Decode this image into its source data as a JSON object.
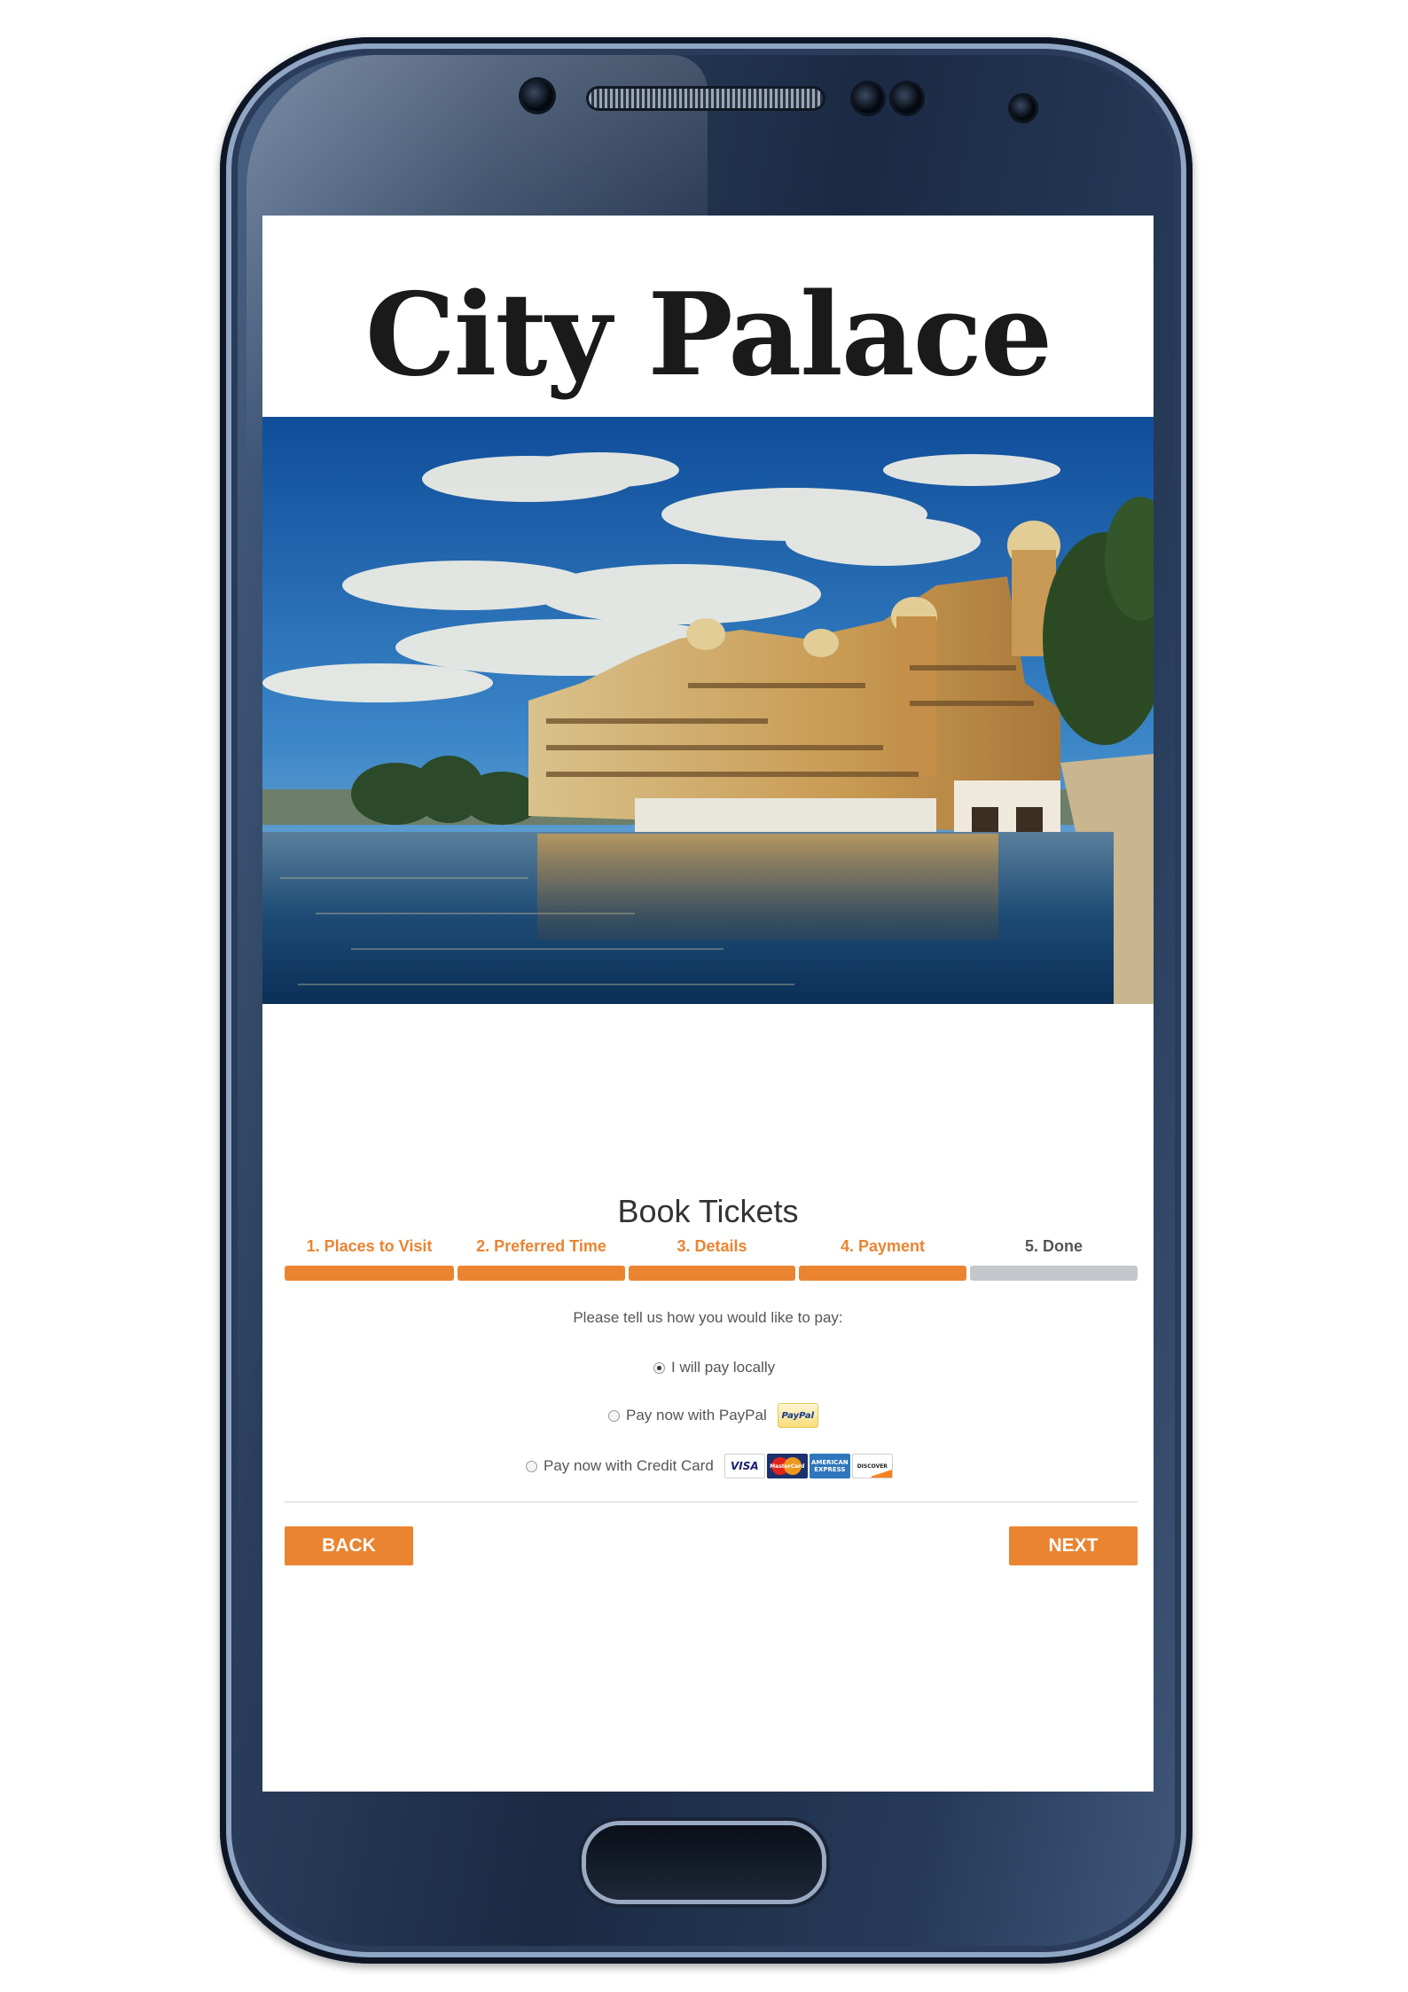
{
  "device": {
    "frame_color": "#1b2a43",
    "accent_orange": "#ea8431",
    "inactive_gray": "#c4c7cc"
  },
  "page": {
    "title": "City Palace",
    "photo_icon": "city-palace-photo"
  },
  "booking": {
    "title": "Book Tickets",
    "steps": [
      {
        "label": "1. Places to Visit",
        "state": "complete"
      },
      {
        "label": "2. Preferred Time",
        "state": "complete"
      },
      {
        "label": "3. Details",
        "state": "complete"
      },
      {
        "label": "4. Payment",
        "state": "active"
      },
      {
        "label": "5. Done",
        "state": "pending"
      }
    ],
    "prompt": "Please tell us how you would like to pay:",
    "options": [
      {
        "label": "I will pay locally",
        "selected": true
      },
      {
        "label": "Pay now with PayPal",
        "selected": false,
        "logo": "PayPal"
      },
      {
        "label": "Pay now with Credit Card",
        "selected": false,
        "logos": [
          "VISA",
          "MasterCard",
          "AMERICAN EXPRESS",
          "DISCOVER"
        ]
      }
    ],
    "back_label": "BACK",
    "next_label": "NEXT"
  }
}
